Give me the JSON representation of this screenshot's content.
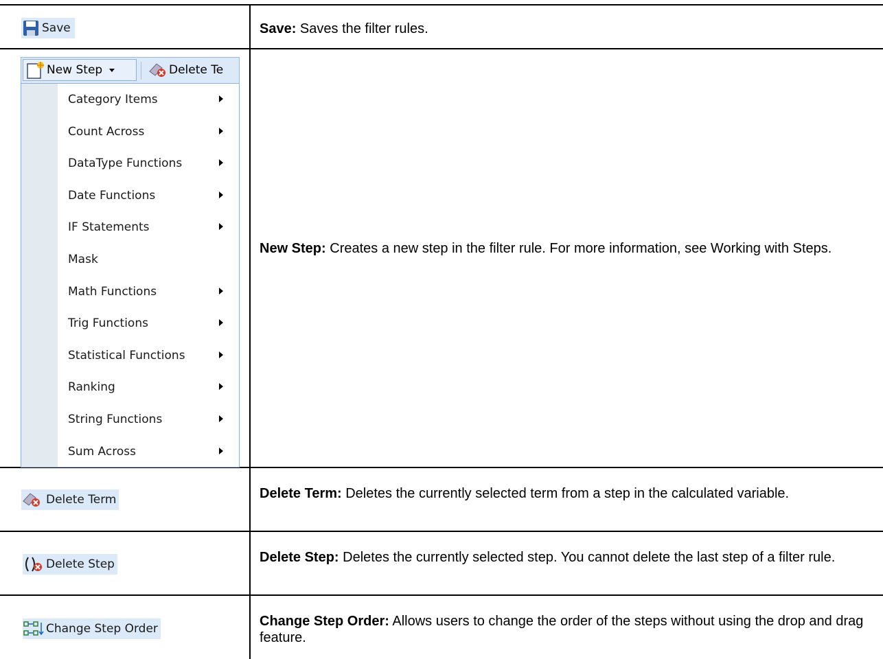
{
  "rows": {
    "save": {
      "button_label": "Save",
      "term": "Save:",
      "desc": " Saves the filter rules."
    },
    "new_step": {
      "term": "New Step:",
      "desc": " Creates a new step in the filter rule. For more information, see Working with Steps."
    },
    "delete_term": {
      "button_label": "Delete Term",
      "term": "Delete Term:",
      "desc": " Deletes the currently selected term from a step in the calculated variable."
    },
    "delete_step": {
      "button_label": "Delete Step",
      "term": "Delete Step:",
      "desc": " Deletes the currently selected step. You cannot delete the last step of a filter rule."
    },
    "change_order": {
      "button_label": "Change Step Order",
      "term": "Change Step Order:",
      "desc": " Allows users to change the order of the steps without using the drop and drag feature."
    }
  },
  "menu": {
    "new_step_label": "New Step",
    "delete_truncated": "Delete Te",
    "items": [
      {
        "label": "Category Items",
        "submenu": true
      },
      {
        "label": "Count Across",
        "submenu": true
      },
      {
        "label": "DataType Functions",
        "submenu": true
      },
      {
        "label": "Date Functions",
        "submenu": true
      },
      {
        "label": "IF Statements",
        "submenu": true
      },
      {
        "label": "Mask",
        "submenu": false
      },
      {
        "label": "Math Functions",
        "submenu": true
      },
      {
        "label": "Trig Functions",
        "submenu": true
      },
      {
        "label": "Statistical Functions",
        "submenu": true
      },
      {
        "label": "Ranking",
        "submenu": true
      },
      {
        "label": "String Functions",
        "submenu": true
      },
      {
        "label": "Sum Across",
        "submenu": true
      }
    ]
  },
  "icons": {
    "save": "floppy-disk-icon",
    "new_step": "new-document-icon",
    "delete_term": "eraser-delete-icon",
    "delete_step": "parenthesis-delete-icon",
    "change_order": "reorder-arrows-icon"
  },
  "colors": {
    "highlight": "#dbe9f9",
    "menu_border": "#8fb1d9",
    "menu_gutter": "#e3ebf0"
  }
}
